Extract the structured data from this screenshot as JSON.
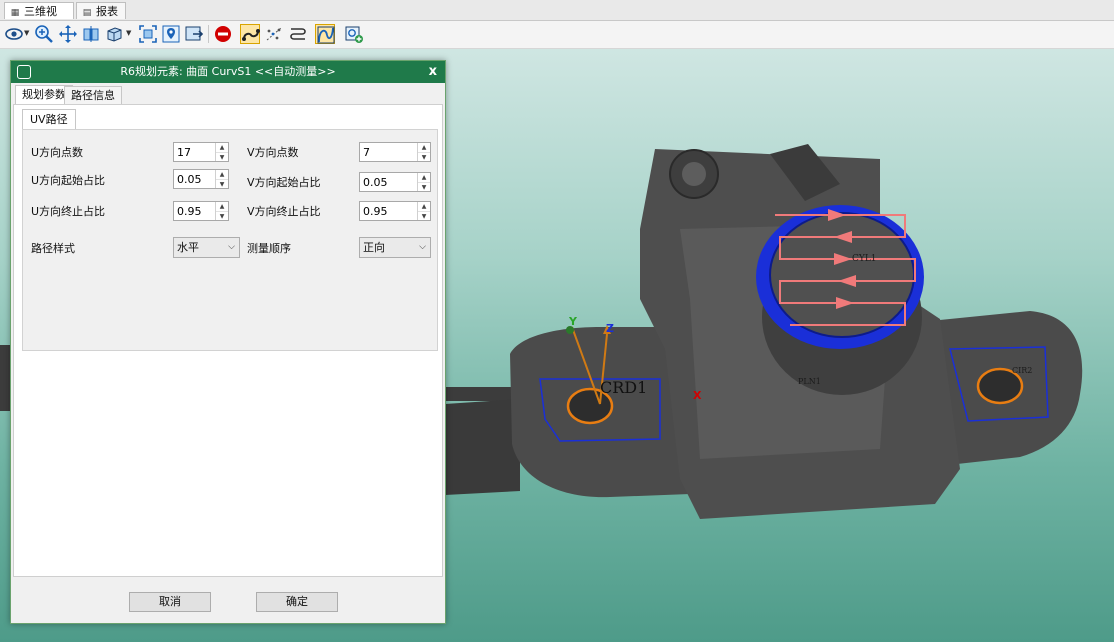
{
  "tabs": [
    {
      "label": "三维视图",
      "icon": "3d-view-icon",
      "active": true
    },
    {
      "label": "报表",
      "icon": "report-icon",
      "active": false
    }
  ],
  "toolbar": {
    "buttons": [
      {
        "icon": "eye-icon",
        "dropdown": true
      },
      {
        "icon": "zoom-in-icon"
      },
      {
        "icon": "pan-move-icon"
      },
      {
        "icon": "view-front-icon"
      },
      {
        "icon": "view-cube-icon",
        "dropdown": true
      },
      {
        "icon": "fit-view-icon"
      },
      {
        "icon": "locate-pin-icon"
      },
      {
        "icon": "export-view-icon"
      },
      {
        "icon": "stop-icon"
      },
      {
        "icon": "path-link-icon",
        "toggled": true
      },
      {
        "icon": "scatter-points-icon"
      },
      {
        "icon": "route-icon"
      },
      {
        "icon": "curve-path-icon",
        "toggled": true
      },
      {
        "icon": "add-measure-icon"
      }
    ],
    "colors": {
      "stop": "#d10000",
      "toggle_bg": "#fde6a6"
    }
  },
  "dialog": {
    "title": "R6规划元素: 曲面 CurvS1 <<自动测量>>",
    "close_label": "x",
    "tabs": [
      {
        "label": "规划参数",
        "active": true
      },
      {
        "label": "路径信息",
        "active": false
      }
    ],
    "inner_tab": "UV路径",
    "fields": {
      "u_points": {
        "label": "U方向点数",
        "value": "17"
      },
      "v_points": {
        "label": "V方向点数",
        "value": "7"
      },
      "u_start": {
        "label": "U方向起始占比",
        "value": "0.05"
      },
      "v_start": {
        "label": "V方向起始占比",
        "value": "0.05"
      },
      "u_end": {
        "label": "U方向终止占比",
        "value": "0.95"
      },
      "v_end": {
        "label": "V方向终止占比",
        "value": "0.95"
      },
      "path_style": {
        "label": "路径样式",
        "value": "水平"
      },
      "measure_order": {
        "label": "测量顺序",
        "value": "正向"
      }
    },
    "cancel_label": "取消",
    "ok_label": "确定"
  },
  "viewport": {
    "labels": {
      "crd": "CRD1",
      "cyl": "CYL1",
      "plane": "PLN1",
      "cir": "CIR2",
      "axis_y": "Y",
      "axis_z": "Z",
      "axis_x": "X"
    },
    "colors": {
      "part": "#4a4a4a",
      "path_arrows": "#f07a7a",
      "cylinder": "#1a2fd8",
      "circle": "#e87d12",
      "axis": "#d07a14"
    }
  }
}
